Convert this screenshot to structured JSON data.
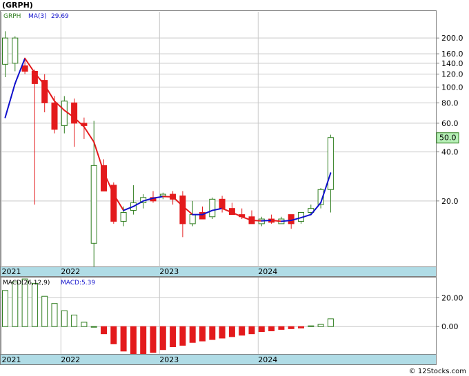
{
  "ticker": "(GRPH)",
  "footer": "© 12Stocks.com",
  "colors": {
    "up": "#2e7d1e",
    "down": "#e31a1c",
    "ma_down": "#e31a1c",
    "ma_up": "#1010cc",
    "grid": "#c8c8c8",
    "axis_band": "#b0dce6",
    "last_price_bg": "#b7f0b7"
  },
  "chart_data": [
    {
      "type": "candlestick",
      "scale": "log",
      "ylim": [
        8,
        290
      ],
      "legend": {
        "symbol": "GRPH",
        "ma_label": "MA(3)",
        "ma_value": "29.69"
      },
      "last_price_label": "50.0",
      "y_ticks": [
        {
          "value": 200,
          "label": "200.0"
        },
        {
          "value": 160,
          "label": "160.0"
        },
        {
          "value": 140,
          "label": "140.0"
        },
        {
          "value": 120,
          "label": "120.0"
        },
        {
          "value": 100,
          "label": "100.0"
        },
        {
          "value": 80,
          "label": "80.0"
        },
        {
          "value": 60,
          "label": "60.0"
        },
        {
          "value": 40,
          "label": "40.0"
        },
        {
          "value": 20,
          "label": "20.0"
        }
      ],
      "x_labels": [
        {
          "label": "2021",
          "index": 0
        },
        {
          "label": "2022",
          "index": 6
        },
        {
          "label": "2023",
          "index": 16
        },
        {
          "label": "2024",
          "index": 26
        }
      ],
      "candles": [
        {
          "o": 138,
          "h": 220,
          "l": 115,
          "c": 200
        },
        {
          "o": 140,
          "h": 205,
          "l": 125,
          "c": 200
        },
        {
          "o": 135,
          "h": 150,
          "l": 120,
          "c": 125
        },
        {
          "o": 125,
          "h": 128,
          "l": 19,
          "c": 105
        },
        {
          "o": 110,
          "h": 120,
          "l": 70,
          "c": 80
        },
        {
          "o": 80,
          "h": 88,
          "l": 52,
          "c": 55
        },
        {
          "o": 58,
          "h": 88,
          "l": 52,
          "c": 82
        },
        {
          "o": 80,
          "h": 85,
          "l": 43,
          "c": 60
        },
        {
          "o": 60,
          "h": 65,
          "l": 48,
          "c": 58
        },
        {
          "o": 11,
          "h": 62,
          "l": 7,
          "c": 33
        },
        {
          "o": 33,
          "h": 36,
          "l": 23,
          "c": 23
        },
        {
          "o": 25,
          "h": 26,
          "l": 14.5,
          "c": 15
        },
        {
          "o": 15,
          "h": 18.5,
          "l": 14,
          "c": 17
        },
        {
          "o": 17.5,
          "h": 25,
          "l": 16.5,
          "c": 19.5
        },
        {
          "o": 19.5,
          "h": 22,
          "l": 18,
          "c": 21
        },
        {
          "o": 21,
          "h": 23,
          "l": 19.5,
          "c": 20
        },
        {
          "o": 21.5,
          "h": 22.5,
          "l": 20.5,
          "c": 22
        },
        {
          "o": 22,
          "h": 23,
          "l": 19,
          "c": 20.5
        },
        {
          "o": 21.5,
          "h": 23,
          "l": 12,
          "c": 14.5
        },
        {
          "o": 14.5,
          "h": 20,
          "l": 14,
          "c": 16.5
        },
        {
          "o": 17,
          "h": 18.5,
          "l": 15.5,
          "c": 15.5
        },
        {
          "o": 16,
          "h": 21,
          "l": 15.5,
          "c": 20.5
        },
        {
          "o": 20.5,
          "h": 21.5,
          "l": 17,
          "c": 18
        },
        {
          "o": 18,
          "h": 19.5,
          "l": 16.5,
          "c": 16.5
        },
        {
          "o": 16.5,
          "h": 18,
          "l": 15.5,
          "c": 16
        },
        {
          "o": 16,
          "h": 17.5,
          "l": 14.5,
          "c": 14.5
        },
        {
          "o": 14.5,
          "h": 16,
          "l": 14,
          "c": 15.5
        },
        {
          "o": 15.5,
          "h": 16.5,
          "l": 14.5,
          "c": 14.8
        },
        {
          "o": 14.5,
          "h": 16,
          "l": 14.5,
          "c": 15.5
        },
        {
          "o": 16.5,
          "h": 16,
          "l": 13.5,
          "c": 14.5
        },
        {
          "o": 15,
          "h": 17,
          "l": 14.5,
          "c": 17
        },
        {
          "o": 17,
          "h": 19,
          "l": 16.5,
          "c": 18
        },
        {
          "o": 19,
          "h": 24,
          "l": 18,
          "c": 23.5
        },
        {
          "o": 23.5,
          "h": 51,
          "l": 17,
          "c": 49
        }
      ],
      "ma": [
        {
          "i": 0,
          "v": 65
        },
        {
          "i": 1,
          "v": 105
        },
        {
          "i": 2,
          "v": 150
        },
        {
          "i": 3,
          "v": 122
        },
        {
          "i": 4,
          "v": 103
        },
        {
          "i": 5,
          "v": 82
        },
        {
          "i": 6,
          "v": 72
        },
        {
          "i": 7,
          "v": 65
        },
        {
          "i": 8,
          "v": 57
        },
        {
          "i": 9,
          "v": 46
        },
        {
          "i": 10,
          "v": 30
        },
        {
          "i": 11,
          "v": 22
        },
        {
          "i": 12,
          "v": 17.5
        },
        {
          "i": 13,
          "v": 18.5
        },
        {
          "i": 14,
          "v": 20
        },
        {
          "i": 15,
          "v": 20.8
        },
        {
          "i": 16,
          "v": 21.3
        },
        {
          "i": 17,
          "v": 21.2
        },
        {
          "i": 18,
          "v": 18.6
        },
        {
          "i": 19,
          "v": 16.5
        },
        {
          "i": 20,
          "v": 16.5
        },
        {
          "i": 21,
          "v": 17.5
        },
        {
          "i": 22,
          "v": 18
        },
        {
          "i": 23,
          "v": 17
        },
        {
          "i": 24,
          "v": 16
        },
        {
          "i": 25,
          "v": 15.2
        },
        {
          "i": 26,
          "v": 15.1
        },
        {
          "i": 27,
          "v": 15.2
        },
        {
          "i": 28,
          "v": 15
        },
        {
          "i": 29,
          "v": 15.2
        },
        {
          "i": 30,
          "v": 15.8
        },
        {
          "i": 31,
          "v": 16.5
        },
        {
          "i": 32,
          "v": 19.5
        },
        {
          "i": 33,
          "v": 29.69
        }
      ]
    },
    {
      "type": "bar",
      "legend": {
        "label": "MACD(26,12,9)",
        "value_label": "MACD:5.39"
      },
      "ylim": [
        -19,
        34
      ],
      "y_ticks": [
        {
          "value": 20,
          "label": "20.00"
        },
        {
          "value": 0,
          "label": "0.00"
        }
      ],
      "x_labels": [
        {
          "label": "2021",
          "index": 0
        },
        {
          "label": "2022",
          "index": 6
        },
        {
          "label": "2023",
          "index": 16
        },
        {
          "label": "2024",
          "index": 26
        }
      ],
      "values": [
        25,
        31,
        33,
        30,
        21,
        16,
        11,
        8,
        3,
        0,
        -5,
        -12,
        -17,
        -19,
        -19,
        -18,
        -16,
        -14,
        -13,
        -11,
        -10,
        -9,
        -8,
        -7,
        -6,
        -5,
        -3.5,
        -3,
        -2,
        -1.5,
        -1,
        0.5,
        1.5,
        5.39
      ]
    }
  ]
}
